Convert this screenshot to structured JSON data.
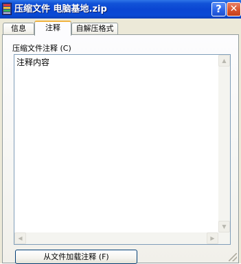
{
  "window": {
    "title": "压缩文件 电脑基地.zip",
    "help_label": "?",
    "close_label": "✕"
  },
  "tabs": [
    {
      "label": "信息"
    },
    {
      "label": "注释"
    },
    {
      "label": "自解压格式"
    }
  ],
  "comment_section": {
    "label": "压缩文件注释 (C)",
    "content": "注释内容"
  },
  "scrollbar": {
    "up_arrow": "▲",
    "down_arrow": "▼",
    "left_arrow": "◀",
    "right_arrow": "▶"
  },
  "load_button_label": "从文件加载注释 (F)",
  "icons": {
    "app": "archive-icon",
    "resize": "resize-grip-icon"
  },
  "colors": {
    "titlebar": "#0a46d2",
    "active_tab_accent": "#f1b43f",
    "close_button": "#d9552e"
  }
}
